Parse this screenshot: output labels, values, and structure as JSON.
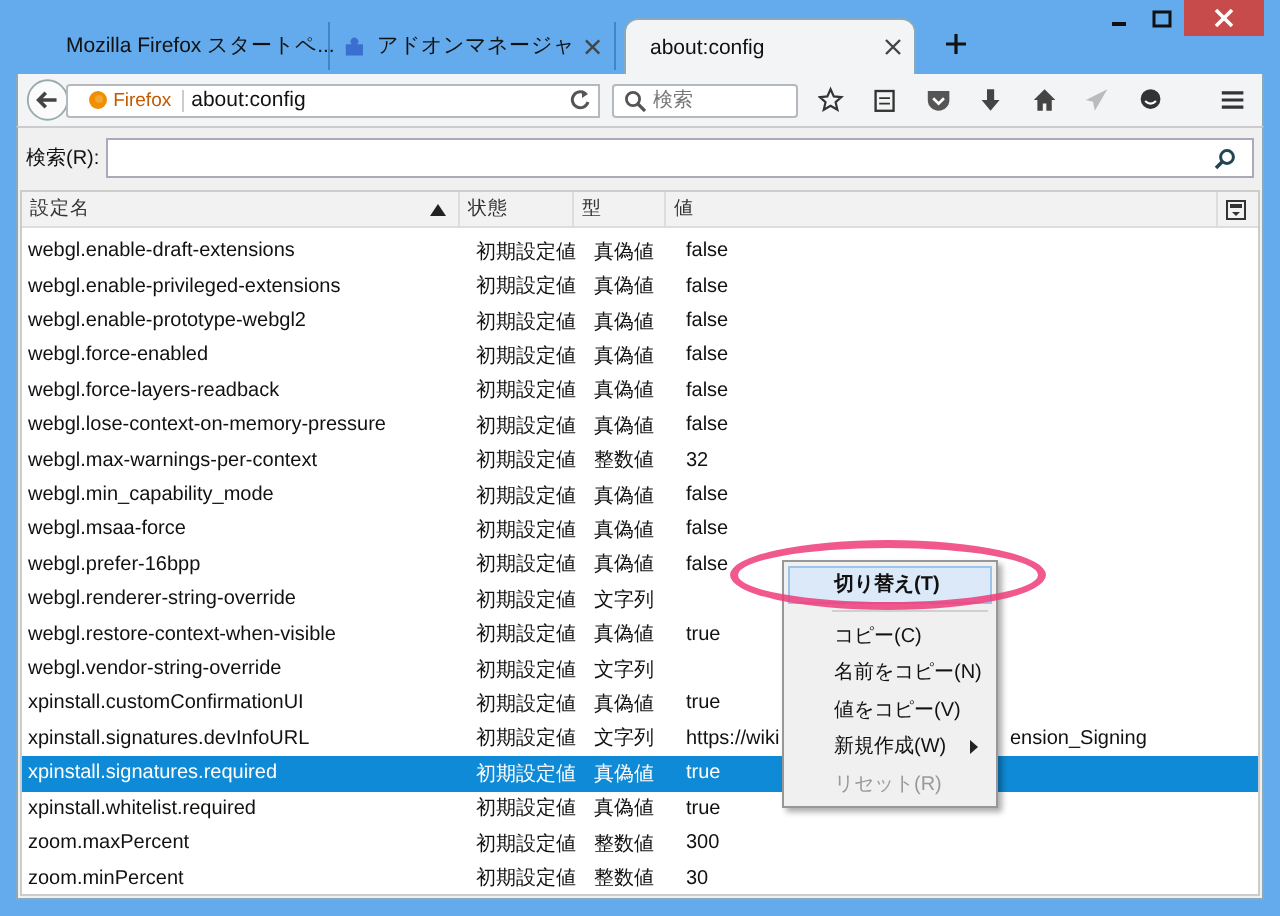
{
  "tabs": [
    {
      "label": "Mozilla Firefox スタートペ...",
      "selected": false
    },
    {
      "label": "アドオンマネージャ",
      "selected": false
    },
    {
      "label": "about:config",
      "selected": true
    }
  ],
  "url_bar": {
    "identity": "Firefox",
    "value": "about:config"
  },
  "search": {
    "placeholder": "検索"
  },
  "filter": {
    "label": "検索(R):"
  },
  "columns": [
    "設定名",
    "状態",
    "型",
    "値"
  ],
  "rows": [
    {
      "name": "webgl.enable-draft-extensions",
      "status": "初期設定値",
      "type": "真偽値",
      "value": "false",
      "selected": false
    },
    {
      "name": "webgl.enable-privileged-extensions",
      "status": "初期設定値",
      "type": "真偽値",
      "value": "false",
      "selected": false
    },
    {
      "name": "webgl.enable-prototype-webgl2",
      "status": "初期設定値",
      "type": "真偽値",
      "value": "false",
      "selected": false
    },
    {
      "name": "webgl.force-enabled",
      "status": "初期設定値",
      "type": "真偽値",
      "value": "false",
      "selected": false
    },
    {
      "name": "webgl.force-layers-readback",
      "status": "初期設定値",
      "type": "真偽値",
      "value": "false",
      "selected": false
    },
    {
      "name": "webgl.lose-context-on-memory-pressure",
      "status": "初期設定値",
      "type": "真偽値",
      "value": "false",
      "selected": false
    },
    {
      "name": "webgl.max-warnings-per-context",
      "status": "初期設定値",
      "type": "整数値",
      "value": "32",
      "selected": false
    },
    {
      "name": "webgl.min_capability_mode",
      "status": "初期設定値",
      "type": "真偽値",
      "value": "false",
      "selected": false
    },
    {
      "name": "webgl.msaa-force",
      "status": "初期設定値",
      "type": "真偽値",
      "value": "false",
      "selected": false
    },
    {
      "name": "webgl.prefer-16bpp",
      "status": "初期設定値",
      "type": "真偽値",
      "value": "false",
      "selected": false
    },
    {
      "name": "webgl.renderer-string-override",
      "status": "初期設定値",
      "type": "文字列",
      "selected": false
    },
    {
      "name": "webgl.restore-context-when-visible",
      "status": "初期設定値",
      "type": "真偽値",
      "value": "true",
      "selected": false
    },
    {
      "name": "webgl.vendor-string-override",
      "status": "初期設定値",
      "type": "文字列",
      "selected": false
    },
    {
      "name": "xpinstall.customConfirmationUI",
      "status": "初期設定値",
      "type": "真偽値",
      "value": "true",
      "selected": false
    },
    {
      "name": "xpinstall.signatures.devInfoURL",
      "status": "初期設定値",
      "type": "文字列",
      "value": "https://wiki",
      "value_tail": "ension_Signing",
      "selected": false
    },
    {
      "name": "xpinstall.signatures.required",
      "status": "初期設定値",
      "type": "真偽値",
      "value": "true",
      "selected": true
    },
    {
      "name": "xpinstall.whitelist.required",
      "status": "初期設定値",
      "type": "真偽値",
      "value": "true",
      "selected": false
    },
    {
      "name": "zoom.maxPercent",
      "status": "初期設定値",
      "type": "整数値",
      "value": "300",
      "selected": false
    },
    {
      "name": "zoom.minPercent",
      "status": "初期設定値",
      "type": "整数値",
      "value": "30",
      "selected": false
    }
  ],
  "context_menu": {
    "highlight_circle": true,
    "items": [
      {
        "kind": "item",
        "label": "切り替え(T)",
        "selected": true,
        "disabled": false
      },
      {
        "kind": "separator"
      },
      {
        "kind": "item",
        "label": "コピー(C)",
        "selected": false,
        "disabled": false
      },
      {
        "kind": "item",
        "label": "名前をコピー(N)",
        "selected": false,
        "disabled": false
      },
      {
        "kind": "item",
        "label": "値をコピー(V)",
        "selected": false,
        "disabled": false
      },
      {
        "kind": "submenu",
        "label": "新規作成(W)",
        "selected": false,
        "disabled": false
      },
      {
        "kind": "item",
        "label": "リセット(R)",
        "selected": false,
        "disabled": true
      }
    ]
  }
}
